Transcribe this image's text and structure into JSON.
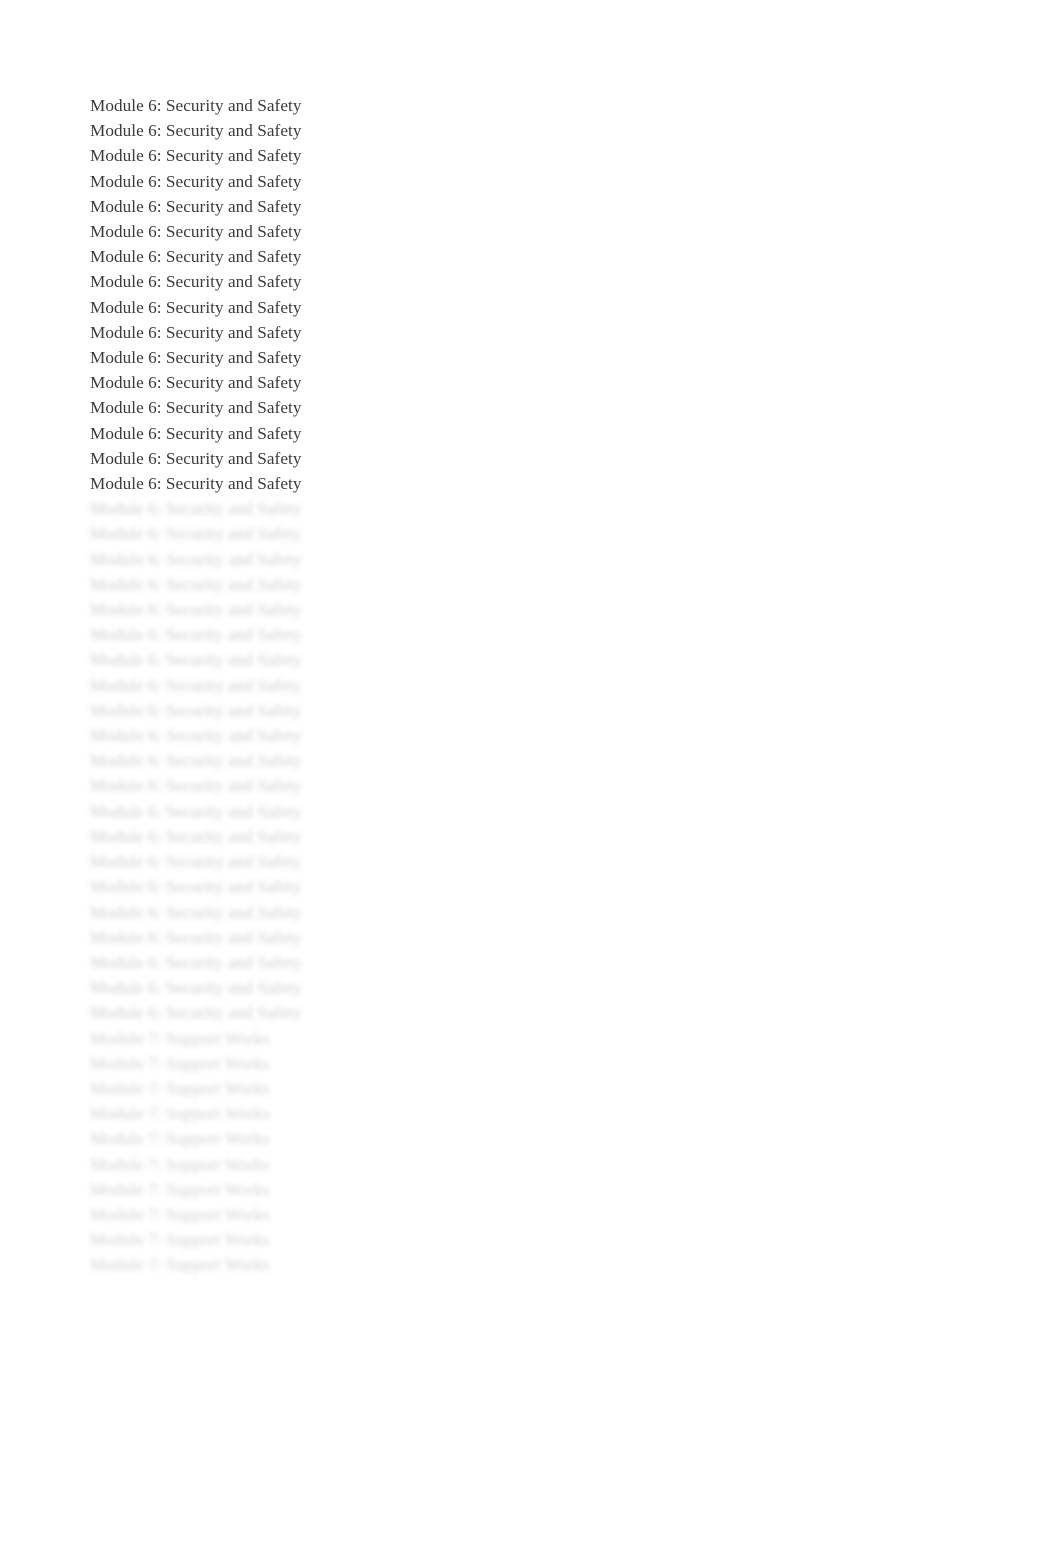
{
  "document": {
    "background_color": "#ffffff",
    "text_color": "#3a3a3a",
    "heading_text": "Module 6: Security and Safety",
    "secondary_text": "Module 7: Support Works",
    "sharp_lines": [
      "Module 6: Security and Safety",
      "Module 6: Security and Safety",
      "Module 6: Security and Safety",
      "Module 6: Security and Safety",
      "Module 6: Security and Safety",
      "Module 6: Security and Safety",
      "Module 6: Security and Safety",
      "Module 6: Security and Safety",
      "Module 6: Security and Safety",
      "Module 6: Security and Safety",
      "Module 6: Security and Safety",
      "Module 6: Security and Safety",
      "Module 6: Security and Safety",
      "Module 6: Security and Safety",
      "Module 6: Security and Safety",
      "Module 6: Security and Safety"
    ],
    "blurred_lines": [
      "Module 6: Security and Safety",
      "Module 6: Security and Safety",
      "Module 6: Security and Safety",
      "Module 6: Security and Safety",
      "Module 6: Security and Safety",
      "Module 6: Security and Safety",
      "Module 6: Security and Safety",
      "Module 6: Security and Safety",
      "Module 6: Security and Safety",
      "Module 6: Security and Safety",
      "Module 6: Security and Safety",
      "Module 6: Security and Safety",
      "Module 6: Security and Safety",
      "Module 6: Security and Safety",
      "Module 6: Security and Safety",
      "Module 6: Security and Safety",
      "Module 6: Security and Safety",
      "Module 6: Security and Safety",
      "Module 6: Security and Safety",
      "Module 6: Security and Safety",
      "Module 6: Security and Safety"
    ],
    "blurred_short_lines": [
      "Module 7: Support Works",
      "Module 7: Support Works",
      "Module 7: Support Works",
      "Module 7: Support Works",
      "Module 7: Support Works",
      "Module 7: Support Works",
      "Module 7: Support Works",
      "Module 7: Support Works",
      "Module 7: Support Works",
      "Module 7: Support Works"
    ]
  }
}
